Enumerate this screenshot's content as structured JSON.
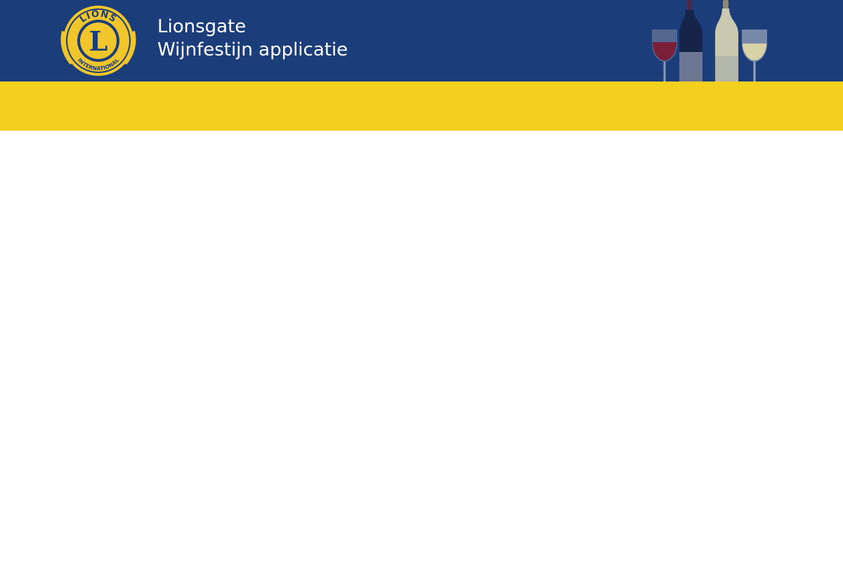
{
  "header": {
    "title_line1": "Lionsgate",
    "title_line2": "Wijnfestijn applicatie",
    "logo_icon": "lions-international-logo-icon",
    "logo_text_top": "LIONS",
    "logo_text_bottom": "INTERNATIONAL",
    "logo_letter": "L",
    "wine_icon": "wine-bottles-and-glasses-icon"
  },
  "colors": {
    "header_bg": "#1b3d79",
    "band_bg": "#f3cf1f",
    "logo_gold": "#f1c62a",
    "text": "#ffffff"
  }
}
